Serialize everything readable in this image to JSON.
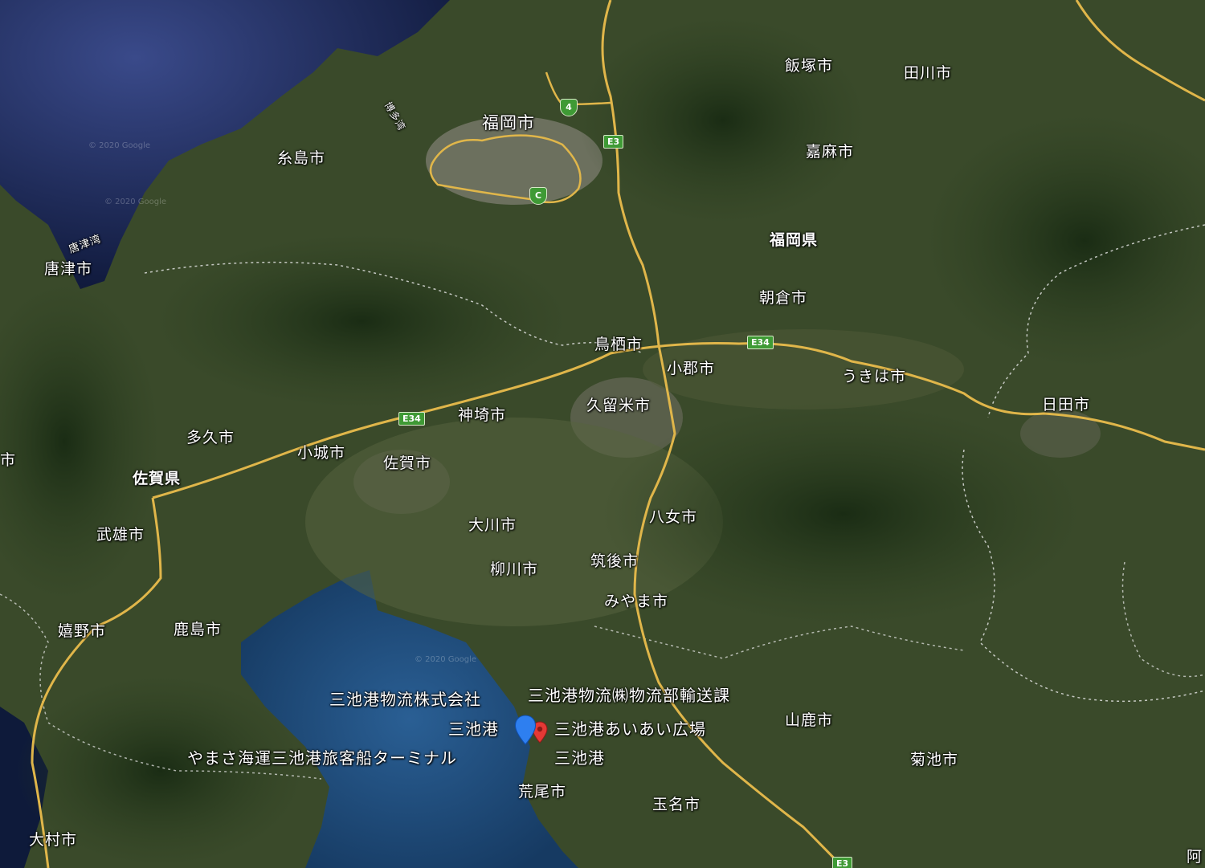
{
  "map": {
    "prefectures": [
      {
        "id": "fukuoka",
        "text": "福岡県"
      },
      {
        "id": "saga",
        "text": "佐賀県"
      }
    ],
    "places": [
      {
        "id": "fukuoka-city",
        "text": "福岡市"
      },
      {
        "id": "itoshima",
        "text": "糸島市"
      },
      {
        "id": "karatsu",
        "text": "唐津市"
      },
      {
        "id": "iizuka",
        "text": "飯塚市"
      },
      {
        "id": "tagawa",
        "text": "田川市"
      },
      {
        "id": "kama",
        "text": "嘉麻市"
      },
      {
        "id": "asakura",
        "text": "朝倉市"
      },
      {
        "id": "tosu",
        "text": "鳥栖市"
      },
      {
        "id": "ogori",
        "text": "小郡市"
      },
      {
        "id": "ukiha",
        "text": "うきは市"
      },
      {
        "id": "hita",
        "text": "日田市"
      },
      {
        "id": "kurume",
        "text": "久留米市"
      },
      {
        "id": "kanzaki",
        "text": "神埼市"
      },
      {
        "id": "taku",
        "text": "多久市"
      },
      {
        "id": "ogi",
        "text": "小城市"
      },
      {
        "id": "saga-city",
        "text": "佐賀市"
      },
      {
        "id": "okawa",
        "text": "大川市"
      },
      {
        "id": "yame",
        "text": "八女市"
      },
      {
        "id": "takeo",
        "text": "武雄市"
      },
      {
        "id": "yanagawa",
        "text": "柳川市"
      },
      {
        "id": "chikugo",
        "text": "筑後市"
      },
      {
        "id": "miyama",
        "text": "みやま市"
      },
      {
        "id": "ureshino",
        "text": "嬉野市"
      },
      {
        "id": "kashima",
        "text": "鹿島市"
      },
      {
        "id": "yamaga",
        "text": "山鹿市"
      },
      {
        "id": "kikuchi",
        "text": "菊池市"
      },
      {
        "id": "arao",
        "text": "荒尾市"
      },
      {
        "id": "tamana",
        "text": "玉名市"
      },
      {
        "id": "omura",
        "text": "大村市"
      },
      {
        "id": "edge-left",
        "text": "市"
      },
      {
        "id": "edge-right",
        "text": "阿"
      }
    ],
    "water": [
      {
        "id": "hakata-bay",
        "text": "博多湾"
      },
      {
        "id": "karatsu-bay",
        "text": "唐津湾"
      }
    ],
    "pois": [
      {
        "id": "miike-logistics",
        "text": "三池港物流株式会社"
      },
      {
        "id": "miike-logistics-dept",
        "text": "三池港物流㈱物流部輸送課"
      },
      {
        "id": "miike-port-selected",
        "text": "三池港"
      },
      {
        "id": "aiai-plaza",
        "text": "三池港あいあい広場"
      },
      {
        "id": "yamasa-terminal",
        "text": "やまさ海運三池港旅客船ターミナル"
      },
      {
        "id": "miike-port",
        "text": "三池港"
      }
    ],
    "shields": [
      {
        "id": "route-4",
        "text": "4"
      },
      {
        "id": "route-c",
        "text": "C"
      },
      {
        "id": "e3-north",
        "text": "E3"
      },
      {
        "id": "e34-east",
        "text": "E34"
      },
      {
        "id": "e34-west",
        "text": "E34"
      },
      {
        "id": "e3-south",
        "text": "E3"
      }
    ],
    "copyright": "© 2020 Google",
    "colors": {
      "sea": "#101a3c",
      "bay": "#1e4a7a",
      "land": "#3b4a2a",
      "mountain": "#1f3218",
      "urban": "#8a8a7e",
      "road": "#e0b64a",
      "border": "#e8e8e8",
      "pin_blue": "#2e7ff0",
      "pin_red": "#e53935",
      "shield": "#3f9a35"
    },
    "icons": [
      "map-pin-blue-icon",
      "map-pin-red-icon"
    ]
  }
}
